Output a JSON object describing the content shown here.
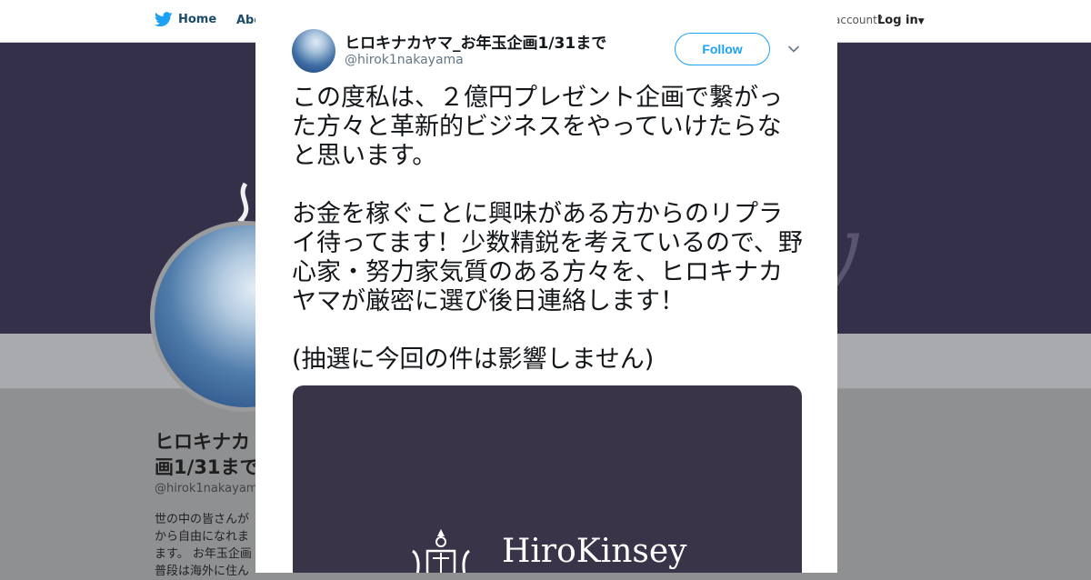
{
  "background": {
    "nav": {
      "home_label": "Home",
      "about_label": "Abo",
      "account_text": "account?",
      "login_label": "Log in"
    },
    "banner_script": "y",
    "profile": {
      "name_line1": "ヒロキナカ",
      "name_line2": "画1/31まで",
      "handle": "@hirok1nakayam",
      "bio_lines": [
        "世の中の皆さんが",
        "から自由になれま",
        "ます。 お年玉企画",
        "普段は海外に住ん"
      ]
    }
  },
  "tweet": {
    "author_name": "ヒロキナカヤマ_お年玉企画1/31まで",
    "author_handle": "@hirok1nakayama",
    "follow_label": "Follow",
    "text": "この度私は、２億円プレゼント企画で繋がった方々と革新的ビジネスをやっていけたらなと思います。\n\nお金を稼ぐことに興味がある方からのリプライ待ってます！少数精鋭を考えているので、野心家・努力家気質のある方々を、ヒロキナカヤマが厳密に選び後日連絡します！\n\n(抽選に今回の件は影響しません)",
    "media": {
      "brand_text": "HiroKinsey"
    }
  },
  "icons": {
    "bird": "twitter-bird-icon",
    "caret": "chevron-down-icon",
    "close": "close-icon"
  },
  "colors": {
    "brand_blue": "#1da1f2",
    "banner": "#35304a",
    "media_bg": "#3a3449"
  }
}
